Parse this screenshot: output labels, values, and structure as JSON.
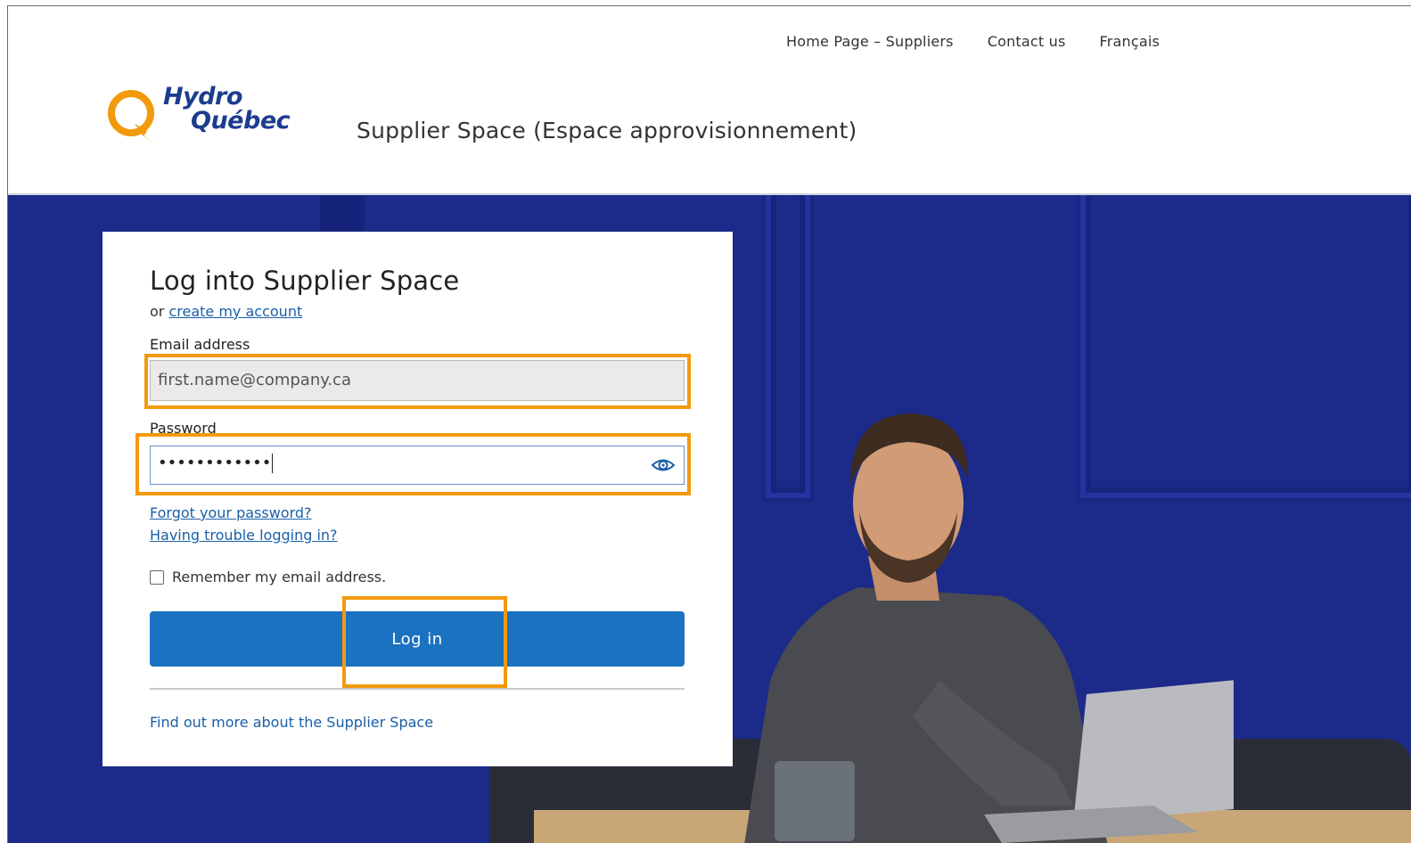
{
  "nav": {
    "items": [
      "Home Page – Suppliers",
      "Contact us",
      "Français"
    ]
  },
  "brand": {
    "logo_line1": "Hydro",
    "logo_line2": "Québec",
    "site_title": "Supplier Space (Espace approvisionnement)",
    "colors": {
      "logo_q": "#f29a0d",
      "logo_text": "#1b3d8f",
      "accent": "#1b72c0",
      "highlight": "#f29a0d"
    }
  },
  "login": {
    "heading": "Log into Supplier Space",
    "or_text": "or",
    "create_account_link": "create my account",
    "email_label": "Email address",
    "email_placeholder": "first.name@company.ca",
    "password_label": "Password",
    "password_value": "••••••••••••",
    "forgot_link": "Forgot your password?",
    "trouble_link": "Having trouble logging in?",
    "remember_label": "Remember my email address.",
    "remember_checked": false,
    "login_button": "Log in",
    "more_link": "Find out more about the Supplier Space"
  },
  "icons": [
    "hydro-quebec-logo-icon",
    "eye-icon",
    "checkbox-icon"
  ]
}
